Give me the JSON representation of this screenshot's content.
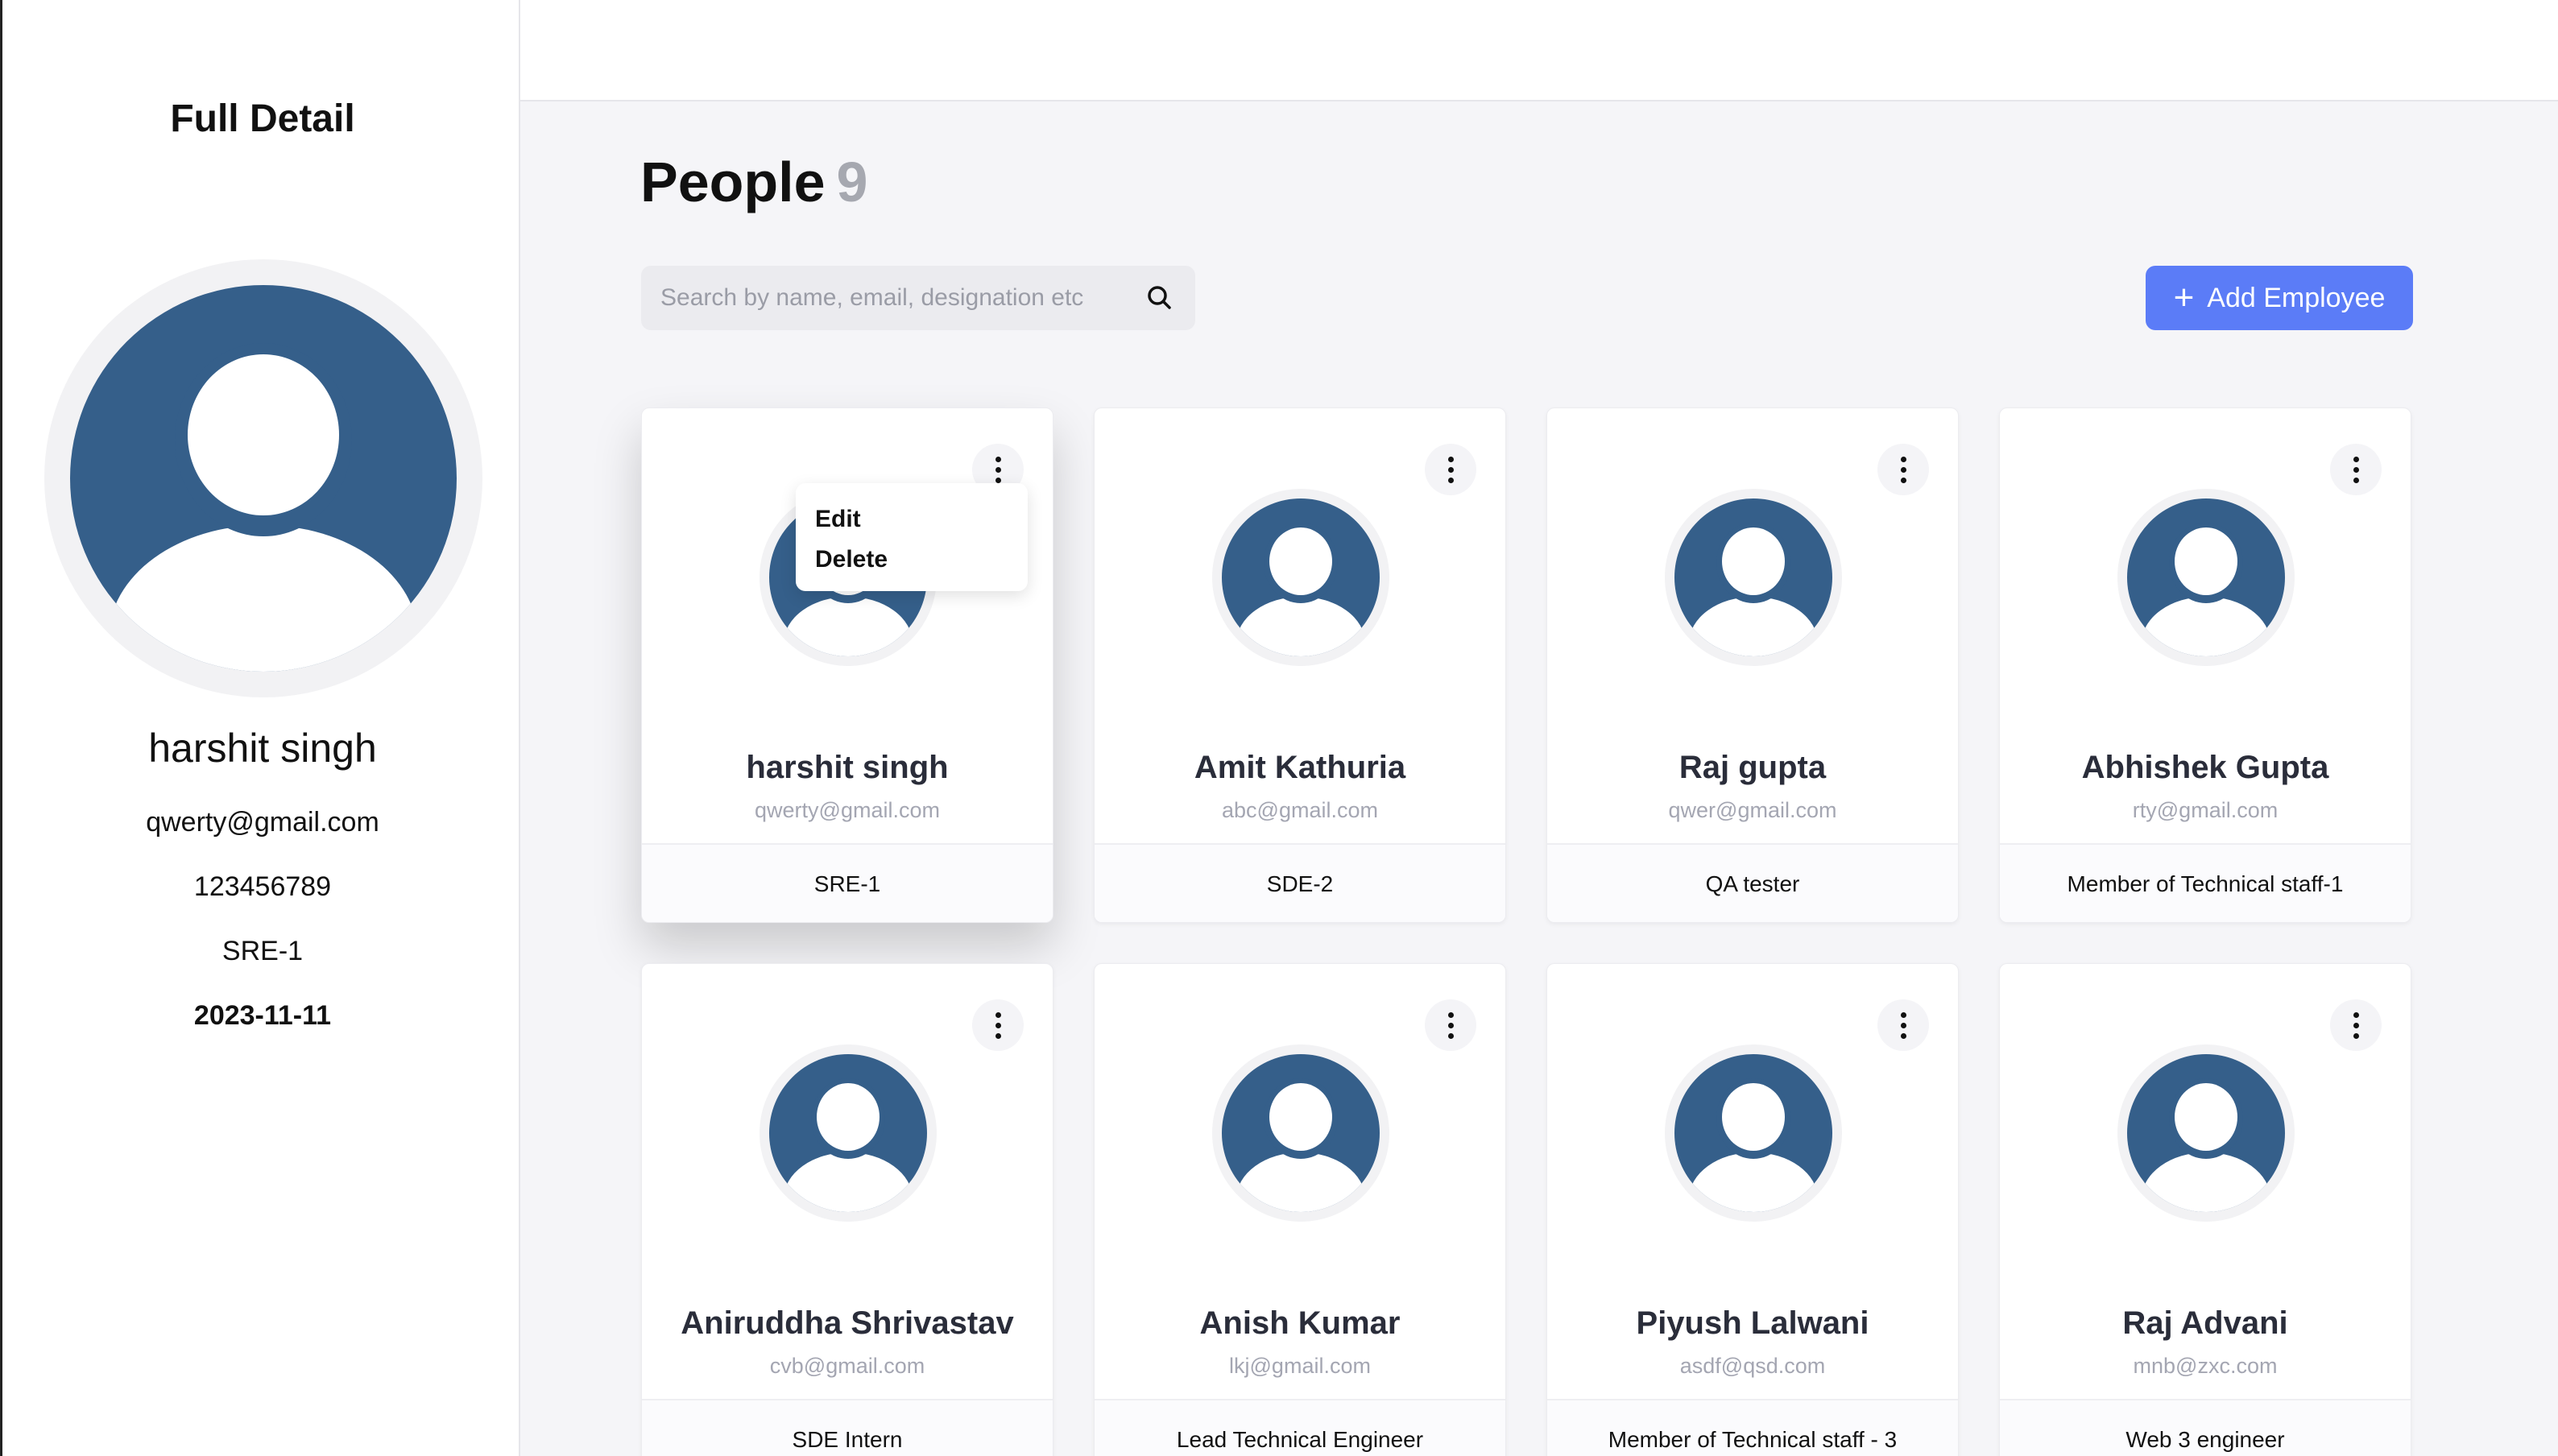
{
  "sidebar": {
    "title": "Full Detail",
    "name": "harshit singh",
    "email": "qwerty@gmail.com",
    "phone": "123456789",
    "designation": "SRE-1",
    "date": "2023-11-11"
  },
  "header": {
    "title": "People",
    "count": "9"
  },
  "search": {
    "placeholder": "Search by name, email, designation etc"
  },
  "add_button": {
    "label": "Add Employee"
  },
  "menu": {
    "edit_label": "Edit",
    "delete_label": "Delete"
  },
  "employees": [
    {
      "name": "harshit singh",
      "email": "qwerty@gmail.com",
      "designation": "SRE-1"
    },
    {
      "name": "Amit Kathuria",
      "email": "abc@gmail.com",
      "designation": "SDE-2"
    },
    {
      "name": "Raj gupta",
      "email": "qwer@gmail.com",
      "designation": "QA tester"
    },
    {
      "name": "Abhishek Gupta",
      "email": "rty@gmail.com",
      "designation": "Member of Technical staff-1"
    },
    {
      "name": "Aniruddha Shrivastav",
      "email": "cvb@gmail.com",
      "designation": "SDE Intern"
    },
    {
      "name": "Anish Kumar",
      "email": "lkj@gmail.com",
      "designation": "Lead Technical Engineer"
    },
    {
      "name": "Piyush Lalwani",
      "email": "asdf@qsd.com",
      "designation": "Member of Technical staff - 3"
    },
    {
      "name": "Raj Advani",
      "email": "mnb@zxc.com",
      "designation": "Web 3 engineer"
    }
  ],
  "colors": {
    "accent": "#5b7cf7",
    "avatar": "#355f8a",
    "avatar_ring": "#f2f2f4"
  },
  "icons": {
    "search": "search-icon",
    "add": "plus-icon",
    "more": "kebab-menu-icon",
    "avatar": "user-avatar-icon"
  }
}
